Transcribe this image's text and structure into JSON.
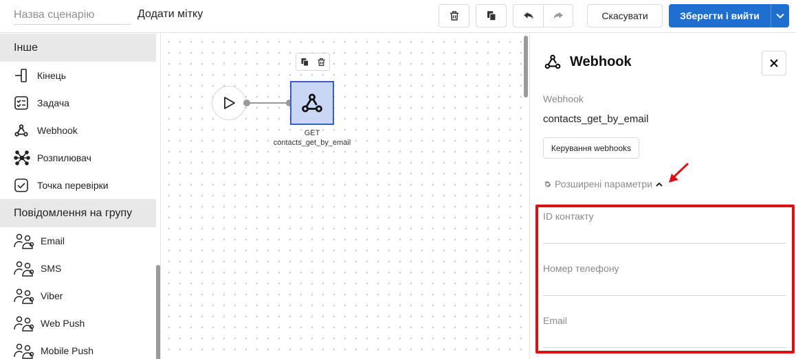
{
  "topbar": {
    "scenario_name_placeholder": "Назва сценарію",
    "add_tag_label": "Додати мітку",
    "cancel_label": "Скасувати",
    "save_label": "Зберегти і вийти"
  },
  "sidebar": {
    "sections": [
      {
        "title": "Інше",
        "items": [
          {
            "label": "Кінець",
            "icon": "end-icon"
          },
          {
            "label": "Задача",
            "icon": "task-icon"
          },
          {
            "label": "Webhook",
            "icon": "webhook-icon"
          },
          {
            "label": "Розпилювач",
            "icon": "splitter-icon"
          },
          {
            "label": "Точка перевірки",
            "icon": "checkpoint-icon"
          }
        ]
      },
      {
        "title": "Повідомлення на групу",
        "items": [
          {
            "label": "Email",
            "icon": "group-email-icon"
          },
          {
            "label": "SMS",
            "icon": "group-sms-icon"
          },
          {
            "label": "Viber",
            "icon": "group-viber-icon"
          },
          {
            "label": "Web Push",
            "icon": "group-webpush-icon"
          },
          {
            "label": "Mobile Push",
            "icon": "group-mobilepush-icon"
          }
        ]
      }
    ]
  },
  "canvas": {
    "webhook_node": {
      "method": "GET",
      "name": "contacts_get_by_email"
    }
  },
  "panel": {
    "title": "Webhook",
    "webhook_label": "Webhook",
    "webhook_value": "contacts_get_by_email",
    "manage_button": "Керування webhooks",
    "advanced_label": "Розширені параметри",
    "fields": [
      {
        "label": "ID контакту",
        "value": ""
      },
      {
        "label": "Номер телефону",
        "value": ""
      },
      {
        "label": "Email",
        "value": ""
      }
    ]
  },
  "colors": {
    "primary": "#1f6fd1",
    "node_fill": "#c9d7f5",
    "node_border": "#2f62c4",
    "annotation": "#e01010",
    "section_bg": "#e8e8e8"
  }
}
